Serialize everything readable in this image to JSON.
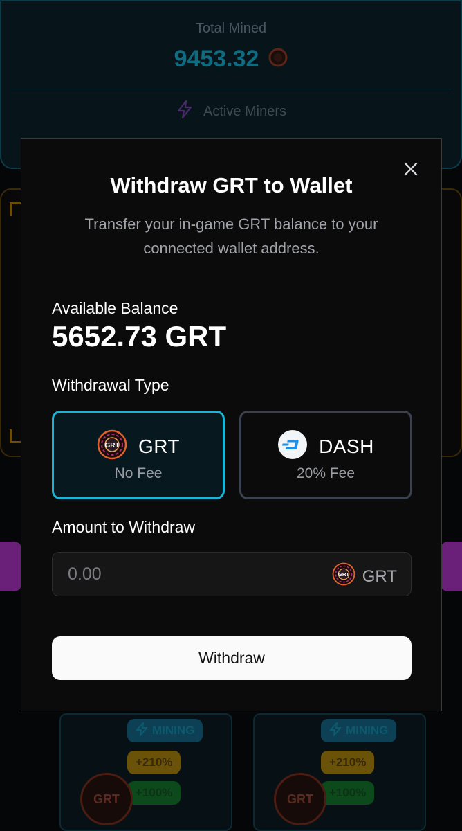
{
  "background": {
    "stats": {
      "total_label": "Total Mined",
      "total_value": "9453.32",
      "active_label": "Active Miners"
    },
    "miners": [
      {
        "status": "MINING",
        "boost1": "+210%",
        "boost2": "+100%",
        "coin_text": "GRT"
      },
      {
        "status": "MINING",
        "boost1": "+210%",
        "boost2": "+100%",
        "coin_text": "GRT"
      }
    ]
  },
  "modal": {
    "title": "Withdraw GRT to Wallet",
    "description": "Transfer your in-game GRT balance to your connected wallet address.",
    "balance_label": "Available Balance",
    "balance_value": "5652.73 GRT",
    "type_label": "Withdrawal Type",
    "types": [
      {
        "name": "GRT",
        "fee": "No Fee",
        "icon": "grt-coin-icon",
        "selected": true
      },
      {
        "name": "DASH",
        "fee": "20% Fee",
        "icon": "dash-icon",
        "selected": false
      }
    ],
    "amount_label": "Amount to Withdraw",
    "amount_placeholder": "0.00",
    "amount_unit": "GRT",
    "withdraw_label": "Withdraw"
  },
  "colors": {
    "accent": "#1ab4d6",
    "modal_bg": "#0b0b0c",
    "button_bg": "#fafafa"
  }
}
